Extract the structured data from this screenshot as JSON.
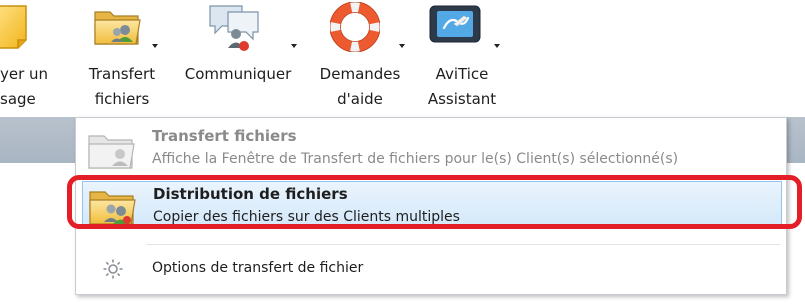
{
  "ribbon": {
    "buttons": [
      {
        "label_line1": "yer un",
        "label_line2": "sage",
        "icon": "message-note-icon"
      },
      {
        "label_line1": "Transfert",
        "label_line2": "fichiers",
        "icon": "folder-user-icon"
      },
      {
        "label_line1": "Communiquer",
        "label_line2": "",
        "icon": "chat-users-icon"
      },
      {
        "label_line1": "Demandes",
        "label_line2": "d'aide",
        "icon": "lifebuoy-icon"
      },
      {
        "label_line1": "AviTice",
        "label_line2": "Assistant",
        "icon": "assistant-tablet-icon"
      }
    ]
  },
  "menu": {
    "items": [
      {
        "title": "Transfert fichiers",
        "description": "Affiche la Fenêtre de Transfert de fichiers pour le(s) Client(s) sélectionné(s)",
        "state": "disabled"
      },
      {
        "title": "Distribution de fichiers",
        "description": "Copier des fichiers sur des Clients multiples",
        "state": "hover"
      },
      {
        "label": "Options de transfert de fichier",
        "icon": "gear-icon"
      }
    ]
  },
  "colors": {
    "highlight": "#e41e26",
    "hover_border": "#94c2ee",
    "band": "#b0bcc8"
  }
}
